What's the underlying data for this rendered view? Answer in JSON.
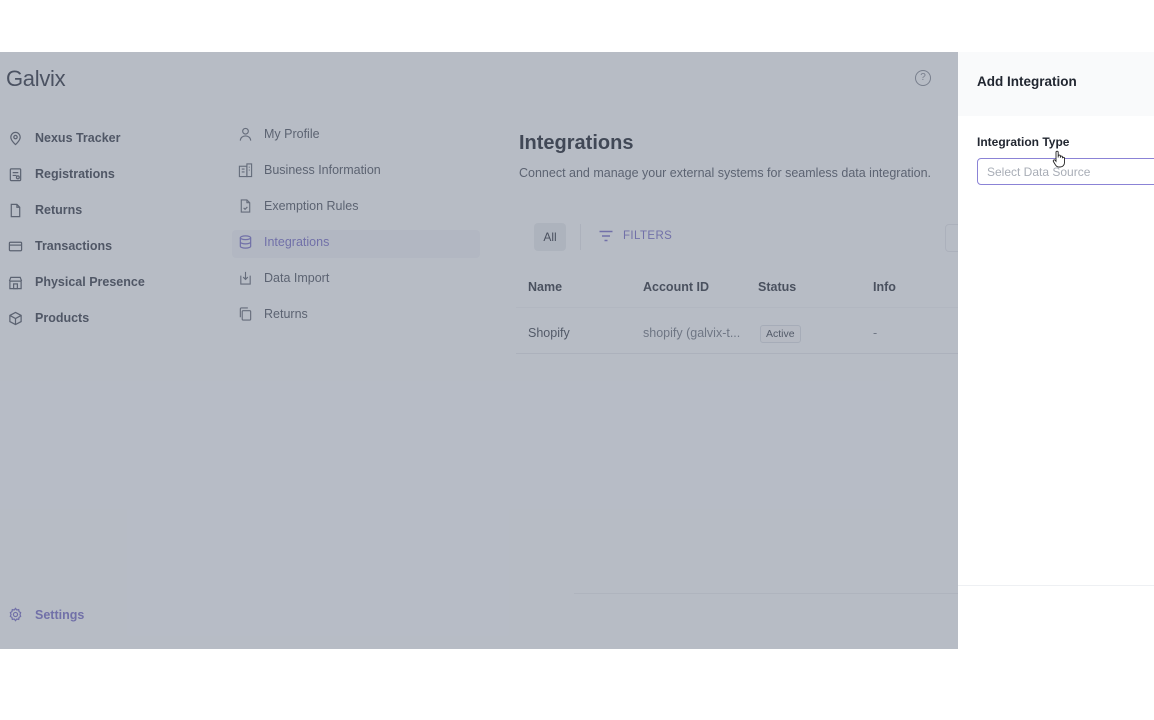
{
  "app": {
    "logo": "Galvix",
    "help_glyph": "?"
  },
  "sidebar": {
    "items": [
      {
        "label": "Nexus Tracker",
        "icon": "map-pin-icon"
      },
      {
        "label": "Registrations",
        "icon": "registration-doc-icon"
      },
      {
        "label": "Returns",
        "icon": "file-icon"
      },
      {
        "label": "Transactions",
        "icon": "card-icon"
      },
      {
        "label": "Physical Presence",
        "icon": "store-icon"
      },
      {
        "label": "Products",
        "icon": "cube-icon"
      }
    ],
    "settings": {
      "label": "Settings",
      "icon": "gear-icon"
    }
  },
  "settings_nav": {
    "items": [
      {
        "label": "My Profile",
        "icon": "user-icon",
        "active": false
      },
      {
        "label": "Business Information",
        "icon": "building-icon",
        "active": false
      },
      {
        "label": "Exemption Rules",
        "icon": "document-icon",
        "active": false
      },
      {
        "label": "Integrations",
        "icon": "database-icon",
        "active": true
      },
      {
        "label": "Data Import",
        "icon": "import-icon",
        "active": false
      },
      {
        "label": "Returns",
        "icon": "copy-icon",
        "active": false
      }
    ]
  },
  "main": {
    "title": "Integrations",
    "subtitle": "Connect and manage your external systems for seamless data integration.",
    "tab_all": "All",
    "filters_label": "FILTERS",
    "table": {
      "headers": [
        "Name",
        "Account ID",
        "Status",
        "Info"
      ],
      "rows": [
        {
          "name": "Shopify",
          "account_id": "shopify (galvix-t...",
          "status": "Active",
          "info": "-"
        }
      ]
    }
  },
  "panel": {
    "title": "Add Integration",
    "field_label": "Integration Type",
    "field_placeholder": "Select Data Source",
    "field_value": ""
  },
  "colors": {
    "accent": "#7e76c9",
    "overlay": "#5f697d"
  }
}
